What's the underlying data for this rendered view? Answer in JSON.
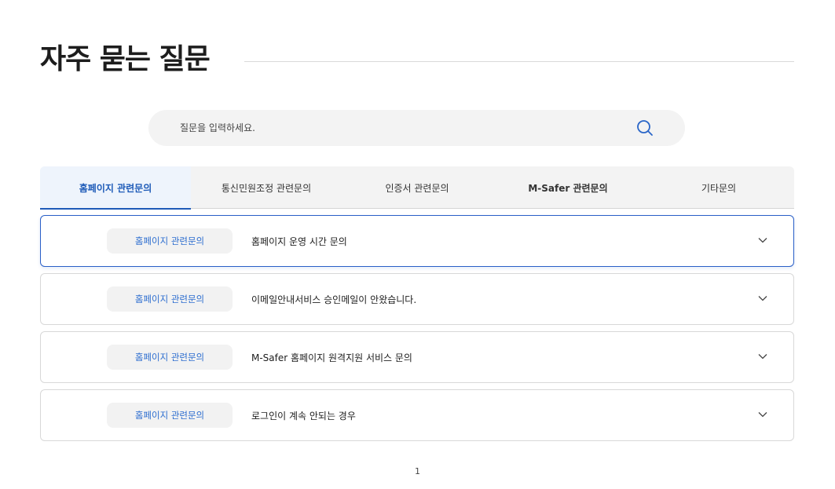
{
  "page": {
    "title": "자주 묻는 질문"
  },
  "search": {
    "placeholder": "질문을 입력하세요.",
    "icon": "search-icon",
    "icon_color": "#2a66c8"
  },
  "tabs": [
    {
      "label": "홈페이지 관련문의",
      "active": true
    },
    {
      "label": "통신민원조정 관련문의",
      "active": false
    },
    {
      "label": "인증서 관련문의",
      "active": false
    },
    {
      "label": "M-Safer 관련문의",
      "active": false
    },
    {
      "label": "기타문의",
      "active": false
    }
  ],
  "faq": [
    {
      "category": "홈페이지 관련문의",
      "question": "홈페이지 운영 시간 문의"
    },
    {
      "category": "홈페이지 관련문의",
      "question": "이메일안내서비스 승인메일이 안왔습니다."
    },
    {
      "category": "홈페이지 관련문의",
      "question": "M-Safer 홈페이지 원격지원 서비스 문의"
    },
    {
      "category": "홈페이지 관련문의",
      "question": "로그인이 계속 안되는 경우"
    }
  ],
  "pagination": {
    "current": "1"
  },
  "colors": {
    "accent": "#1e5bb8",
    "category_text": "#2f6fd0"
  }
}
